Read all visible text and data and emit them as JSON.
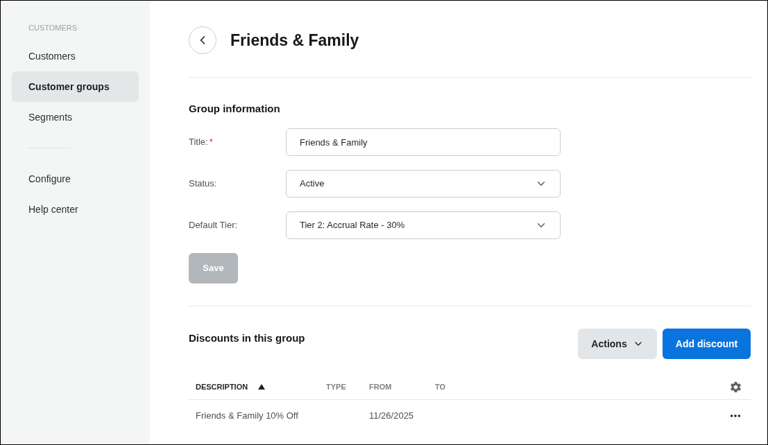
{
  "sidebar": {
    "section_title": "CUSTOMERS",
    "nav_items": [
      {
        "label": "Customers",
        "selected": false
      },
      {
        "label": "Customer groups",
        "selected": true
      },
      {
        "label": "Segments",
        "selected": false
      }
    ],
    "footer_items": [
      {
        "label": "Configure",
        "selected": false
      },
      {
        "label": "Help center",
        "selected": false
      }
    ]
  },
  "header": {
    "title": "Friends & Family"
  },
  "group_information": {
    "heading": "Group information",
    "fields": [
      {
        "kind": "text",
        "label": "Title:",
        "required_mark": "*",
        "value": "Friends & Family"
      },
      {
        "kind": "select",
        "label": "Status:",
        "value": "Active"
      },
      {
        "kind": "select",
        "label": "Default Tier:",
        "value": "Tier 2: Accrual Rate - 30%"
      }
    ],
    "save_button": {
      "label": "Save",
      "disabled": true
    }
  },
  "discounts": {
    "heading": "Discounts in this group",
    "actions_button": "Actions",
    "add_button": "Add discount",
    "table": {
      "columns": [
        {
          "label": "DESCRIPTION",
          "sorted": true
        },
        {
          "label": "TYPE",
          "sorted": false
        },
        {
          "label": "FROM",
          "sorted": false
        },
        {
          "label": "TO",
          "sorted": false
        }
      ],
      "rows": [
        {
          "description": "Friends & Family 10% Off",
          "from": "11/26/2025"
        }
      ]
    }
  }
}
